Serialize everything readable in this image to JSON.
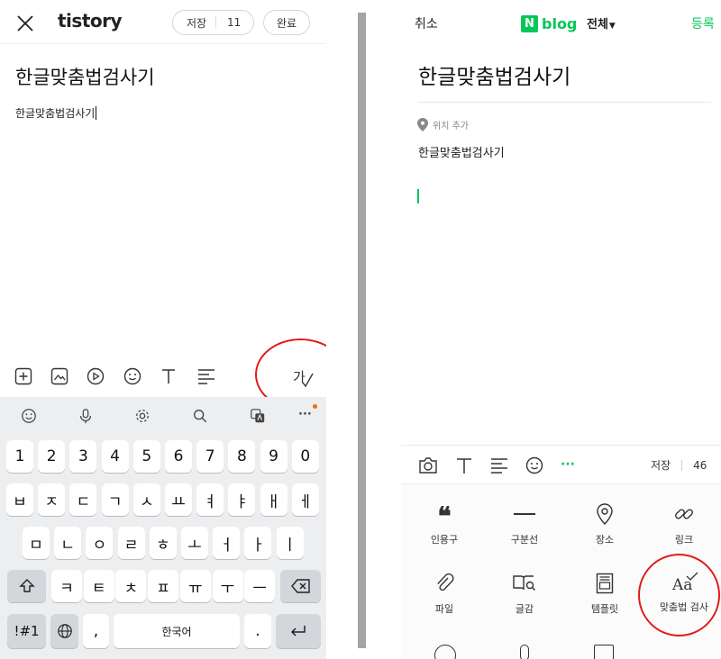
{
  "tistory": {
    "logo": "tistory",
    "save_label": "저장",
    "save_count": "11",
    "done_label": "완료",
    "title": "한글맞춤법검사기",
    "body": "한글맞춤법검사기",
    "spell_icon_glyph": "가",
    "keyboard": {
      "row1": [
        "1",
        "2",
        "3",
        "4",
        "5",
        "6",
        "7",
        "8",
        "9",
        "0"
      ],
      "row2": [
        "ㅂ",
        "ㅈ",
        "ㄷ",
        "ㄱ",
        "ㅅ",
        "ㅛ",
        "ㅕ",
        "ㅑ",
        "ㅐ",
        "ㅔ"
      ],
      "row3": [
        "ㅁ",
        "ㄴ",
        "ㅇ",
        "ㄹ",
        "ㅎ",
        "ㅗ",
        "ㅓ",
        "ㅏ",
        "ㅣ"
      ],
      "row4": [
        "ㅋ",
        "ㅌ",
        "ㅊ",
        "ㅍ",
        "ㅠ",
        "ㅜ",
        "ㅡ"
      ],
      "symbols_key": "!#1",
      "comma_key": ",",
      "space_label": "한국어",
      "period_key": ".",
      "more_glyph": "···"
    }
  },
  "naver": {
    "cancel_label": "취소",
    "logo_badge": "N",
    "logo_text": "blog",
    "visibility_label": "전체",
    "visibility_caret": "▼",
    "publish_label": "등록",
    "title": "한글맞춤법검사기",
    "location_label": "위치 추가",
    "body": "한글맞춤법검사기",
    "save_label": "저장",
    "save_count": "46",
    "more_glyph": "···",
    "tools": [
      {
        "label": "인용구",
        "icon": "quote-icon"
      },
      {
        "label": "구분선",
        "icon": "divider-line-icon"
      },
      {
        "label": "장소",
        "icon": "map-pin-icon"
      },
      {
        "label": "링크",
        "icon": "link-icon"
      },
      {
        "label": "파일",
        "icon": "paperclip-icon"
      },
      {
        "label": "글감",
        "icon": "book-search-icon"
      },
      {
        "label": "템플릿",
        "icon": "template-icon"
      },
      {
        "label": "맞춤법 검사",
        "icon": "spellcheck-icon"
      }
    ],
    "spellcheck_glyph": "Aa"
  },
  "colors": {
    "naver_green": "#03c75a",
    "highlight_red": "#e01b1b",
    "keyboard_bg": "#eceef0",
    "divider_gray": "#a5a5a5"
  }
}
